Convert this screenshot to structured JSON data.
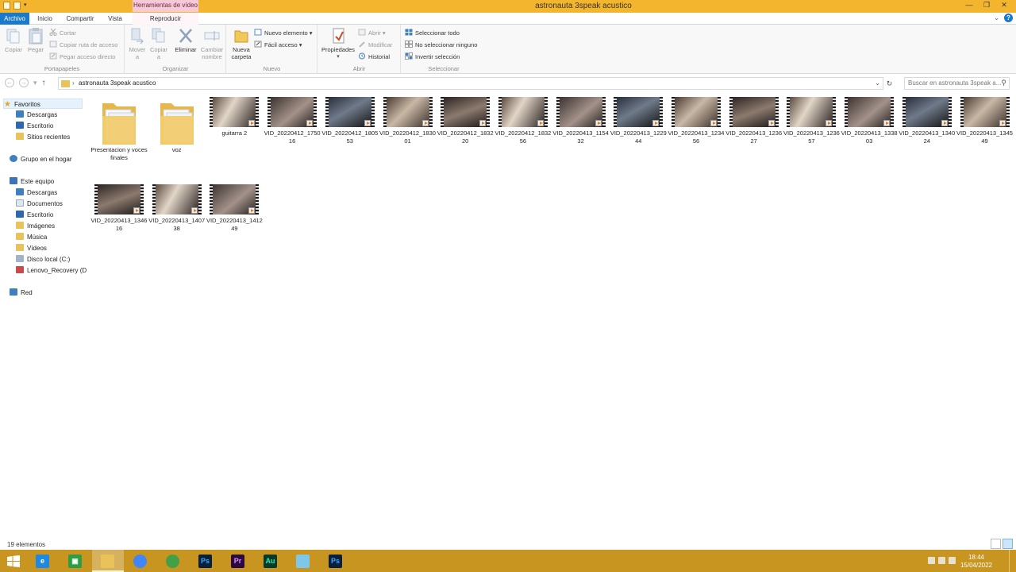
{
  "window": {
    "title": "astronauta 3speak acustico",
    "context_group": "Herramientas de vídeo",
    "controls": [
      "—",
      "❐",
      "✕"
    ]
  },
  "tabs": {
    "archivo": "Archivo",
    "inicio": "Inicio",
    "compartir": "Compartir",
    "vista": "Vista",
    "reproducir": "Reproducir"
  },
  "ribbon": {
    "portapapeles": {
      "label": "Portapapeles",
      "copiar": "Copiar",
      "pegar": "Pegar",
      "cortar": "Cortar",
      "copiar_ruta": "Copiar ruta de acceso",
      "pegar_acceso": "Pegar acceso directo"
    },
    "organizar": {
      "label": "Organizar",
      "mover": "Mover a",
      "copiar": "Copiar a",
      "eliminar": "Eliminar",
      "cambiar": "Cambiar nombre"
    },
    "nuevo": {
      "label": "Nuevo",
      "nueva_carpeta": "Nueva carpeta",
      "nuevo_elemento": "Nuevo elemento ▾",
      "facil_acceso": "Fácil acceso ▾"
    },
    "abrir": {
      "label": "Abrir",
      "propiedades": "Propiedades",
      "abrir": "Abrir ▾",
      "modificar": "Modificar",
      "historial": "Historial"
    },
    "seleccionar": {
      "label": "Seleccionar",
      "todo": "Seleccionar todo",
      "ninguno": "No seleccionar ninguno",
      "invertir": "Invertir selección"
    }
  },
  "address": {
    "path": "astronauta 3speak acustico",
    "search_placeholder": "Buscar en astronauta 3speak a..."
  },
  "nav": {
    "favoritos": "Favoritos",
    "descargas": "Descargas",
    "escritorio": "Escritorio",
    "sitios": "Sitios recientes",
    "grupo_hogar": "Grupo en el hogar",
    "este_equipo": "Este equipo",
    "pc_descargas": "Descargas",
    "pc_documentos": "Documentos",
    "pc_escritorio": "Escritorio",
    "pc_imagenes": "Imágenes",
    "pc_musica": "Música",
    "pc_videos": "Vídeos",
    "pc_disco": "Disco local (C:)",
    "pc_lenovo": "Lenovo_Recovery (D",
    "red": "Red"
  },
  "files": [
    {
      "name": "Presentacion y voces finales",
      "type": "folder"
    },
    {
      "name": "voz",
      "type": "folder"
    },
    {
      "name": "guitarra 2",
      "type": "video"
    },
    {
      "name": "VID_20220412_175016",
      "type": "video"
    },
    {
      "name": "VID_20220412_180553",
      "type": "video"
    },
    {
      "name": "VID_20220412_183001",
      "type": "video"
    },
    {
      "name": "VID_20220412_183220",
      "type": "video"
    },
    {
      "name": "VID_20220412_183256",
      "type": "video"
    },
    {
      "name": "VID_20220413_115432",
      "type": "video"
    },
    {
      "name": "VID_20220413_122944",
      "type": "video"
    },
    {
      "name": "VID_20220413_123456",
      "type": "video"
    },
    {
      "name": "VID_20220413_123627",
      "type": "video"
    },
    {
      "name": "VID_20220413_123657",
      "type": "video"
    },
    {
      "name": "VID_20220413_133803",
      "type": "video"
    },
    {
      "name": "VID_20220413_134024",
      "type": "video"
    },
    {
      "name": "VID_20220413_134549",
      "type": "video"
    },
    {
      "name": "VID_20220413_134616",
      "type": "video"
    },
    {
      "name": "VID_20220413_140738",
      "type": "video"
    },
    {
      "name": "VID_20220413_141249",
      "type": "video"
    }
  ],
  "status": {
    "count": "19 elementos"
  },
  "taskbar": {
    "apps": [
      {
        "icon": "ie-icon",
        "label": "e",
        "color": "#1e88e5"
      },
      {
        "icon": "store-icon",
        "label": "▣",
        "color": "#2e9e44"
      },
      {
        "icon": "file-explorer-icon",
        "label": "",
        "color": "#e9c25a"
      },
      {
        "icon": "chrome-icon",
        "label": "",
        "color": "#4285f4"
      },
      {
        "icon": "shield-app-icon",
        "label": "",
        "color": "#43a047"
      },
      {
        "icon": "photoshop-icon",
        "label": "Ps",
        "color": "#0a1f3c"
      },
      {
        "icon": "premiere-icon",
        "label": "Pr",
        "color": "#2b0a3d"
      },
      {
        "icon": "audition-icon",
        "label": "Au",
        "color": "#063a2a"
      },
      {
        "icon": "notes-icon",
        "label": "",
        "color": "#7fc7e8"
      },
      {
        "icon": "photoshop-icon",
        "label": "Ps",
        "color": "#0a1f3c"
      }
    ],
    "time": "18:44",
    "date": "15/04/2022"
  }
}
